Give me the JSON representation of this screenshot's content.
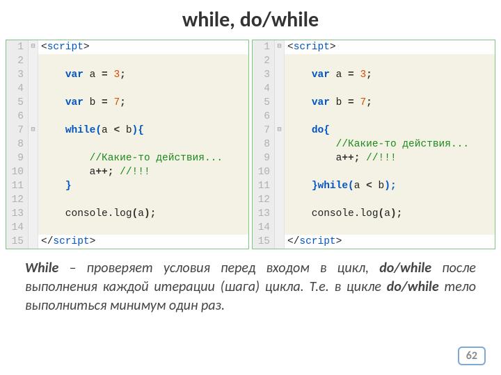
{
  "title": "while, do/while",
  "leftCode": {
    "lines": [
      {
        "num": 1,
        "fold": "⊟",
        "hl": false,
        "html": "&lt;<span class='c-tag'>script</span>&gt;"
      },
      {
        "num": 2,
        "fold": "",
        "hl": true,
        "html": ""
      },
      {
        "num": 3,
        "fold": "",
        "hl": true,
        "html": "    <span class='c-kw'>var</span> a <span class='c-punc'>=</span> <span class='c-num'>3</span><span class='c-punc'>;</span>"
      },
      {
        "num": 4,
        "fold": "",
        "hl": true,
        "html": ""
      },
      {
        "num": 5,
        "fold": "",
        "hl": true,
        "html": "    <span class='c-kw'>var</span> b <span class='c-punc'>=</span> <span class='c-num'>7</span><span class='c-punc'>;</span>"
      },
      {
        "num": 6,
        "fold": "",
        "hl": true,
        "html": ""
      },
      {
        "num": 7,
        "fold": "⊟",
        "hl": true,
        "html": "    <span class='c-kw'>while(</span>a <span class='c-punc'>&lt;</span> b<span class='c-kw'>){</span>"
      },
      {
        "num": 8,
        "fold": "",
        "hl": true,
        "html": ""
      },
      {
        "num": 9,
        "fold": "",
        "hl": true,
        "html": "        <span class='c-com'>//Какие-то действия...</span>"
      },
      {
        "num": 10,
        "fold": "",
        "hl": true,
        "html": "        a<span class='c-punc'>++;</span> <span class='c-com'>//!!!</span>"
      },
      {
        "num": 11,
        "fold": "",
        "hl": true,
        "html": "    <span class='c-kw'>}</span>"
      },
      {
        "num": 12,
        "fold": "",
        "hl": true,
        "html": ""
      },
      {
        "num": 13,
        "fold": "",
        "hl": true,
        "html": "    console.log<span class='c-punc'>(</span>a<span class='c-punc'>);</span>"
      },
      {
        "num": 14,
        "fold": "",
        "hl": true,
        "html": ""
      },
      {
        "num": 15,
        "fold": "",
        "hl": false,
        "html": "&lt;/<span class='c-tag'>script</span>&gt;"
      }
    ]
  },
  "rightCode": {
    "lines": [
      {
        "num": 1,
        "fold": "⊟",
        "hl": false,
        "html": "&lt;<span class='c-tag'>script</span>&gt;"
      },
      {
        "num": 2,
        "fold": "",
        "hl": true,
        "html": ""
      },
      {
        "num": 3,
        "fold": "",
        "hl": true,
        "html": "    <span class='c-kw'>var</span> a <span class='c-punc'>=</span> <span class='c-num'>3</span><span class='c-punc'>;</span>"
      },
      {
        "num": 4,
        "fold": "",
        "hl": true,
        "html": ""
      },
      {
        "num": 5,
        "fold": "",
        "hl": true,
        "html": "    <span class='c-kw'>var</span> b <span class='c-punc'>=</span> <span class='c-num'>7</span><span class='c-punc'>;</span>"
      },
      {
        "num": 6,
        "fold": "",
        "hl": true,
        "html": ""
      },
      {
        "num": 7,
        "fold": "⊟",
        "hl": true,
        "html": "    <span class='c-kw'>do{</span>"
      },
      {
        "num": 8,
        "fold": "",
        "hl": true,
        "html": "        <span class='c-com'>//Какие-то действия...</span>"
      },
      {
        "num": 9,
        "fold": "",
        "hl": true,
        "html": "        a<span class='c-punc'>++;</span> <span class='c-com'>//!!!</span>"
      },
      {
        "num": 10,
        "fold": "",
        "hl": true,
        "html": ""
      },
      {
        "num": 11,
        "fold": "",
        "hl": true,
        "html": "    <span class='c-kw'>}while(</span>a <span class='c-punc'>&lt;</span> b<span class='c-kw'>);</span>"
      },
      {
        "num": 12,
        "fold": "",
        "hl": true,
        "html": ""
      },
      {
        "num": 13,
        "fold": "",
        "hl": true,
        "html": "    console.log<span class='c-punc'>(</span>a<span class='c-punc'>);</span>"
      },
      {
        "num": 14,
        "fold": "",
        "hl": true,
        "html": ""
      },
      {
        "num": 15,
        "fold": "",
        "hl": false,
        "html": "&lt;/<span class='c-tag'>script</span>&gt;"
      }
    ]
  },
  "description": {
    "parts": [
      {
        "bold": true,
        "text": "While"
      },
      {
        "bold": false,
        "text": " – проверяет условия перед входом в цикл, "
      },
      {
        "bold": true,
        "text": "do/while"
      },
      {
        "bold": false,
        "text": " после выполнения каждой итерации (шага) цикла. Т.е. в цикле "
      },
      {
        "bold": true,
        "text": "do/while"
      },
      {
        "bold": false,
        "text": " тело выполниться минимум один раз."
      }
    ]
  },
  "pageNumber": "62"
}
